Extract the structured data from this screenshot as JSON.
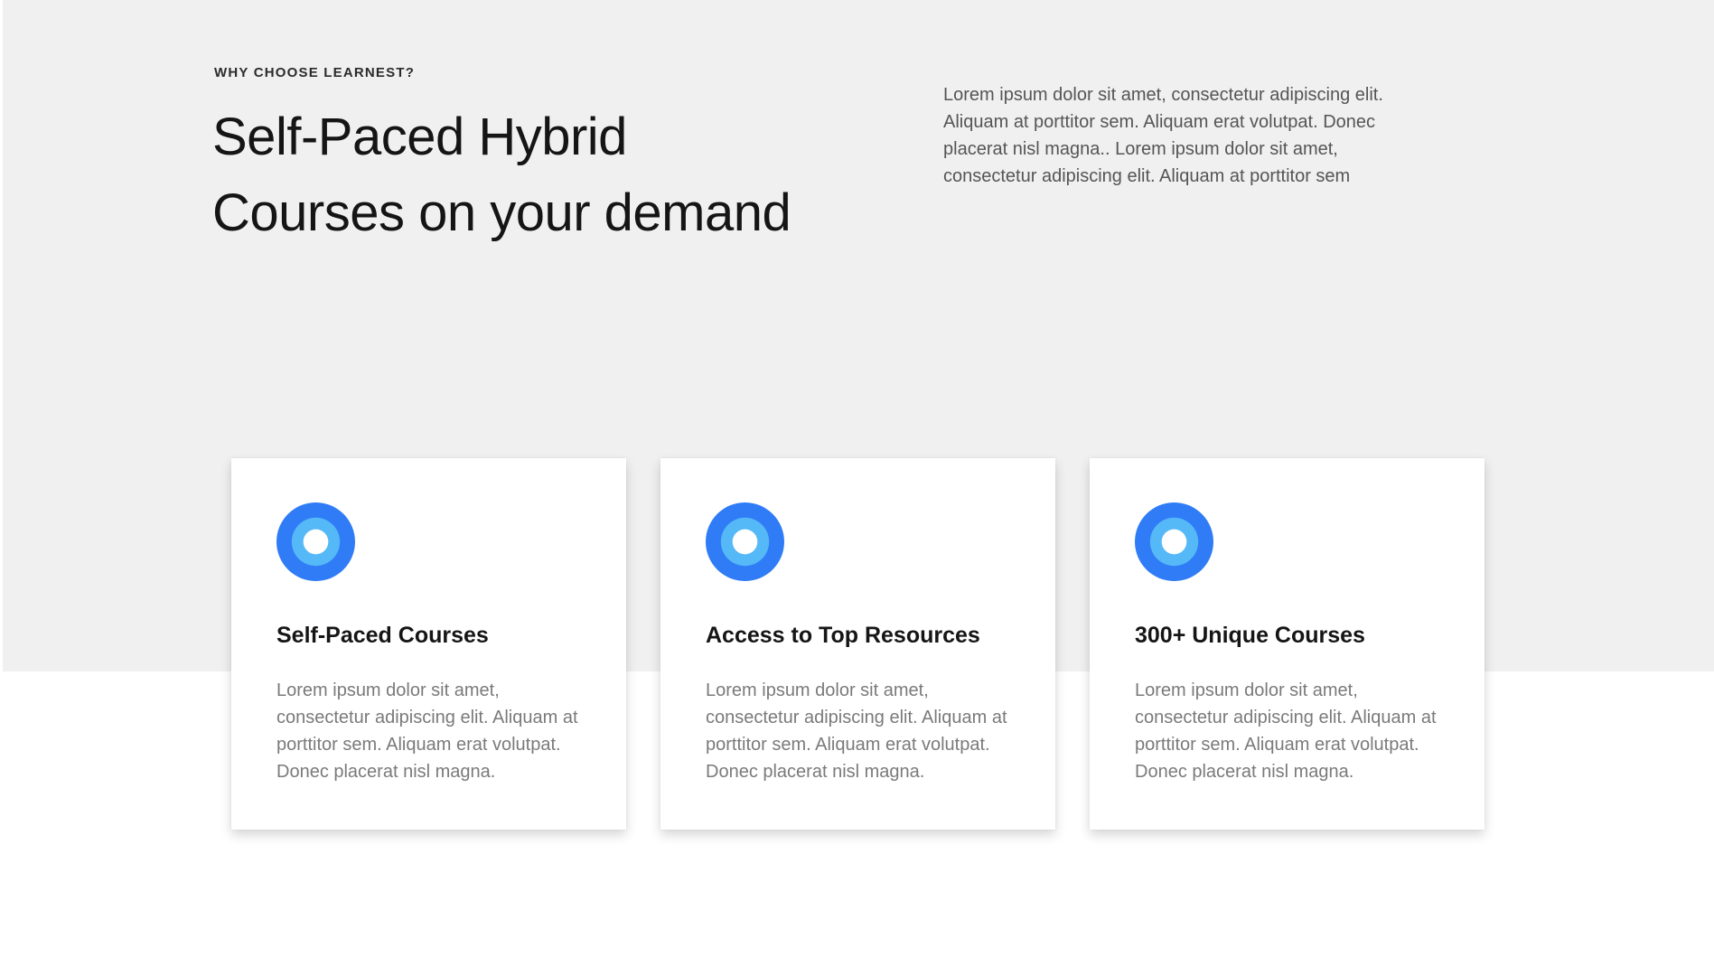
{
  "section": {
    "eyebrow": "WHY CHOOSE LEARNEST?",
    "headline_line1": "Self-Paced Hybrid",
    "headline_line2": "Courses on your demand",
    "intro": "Lorem ipsum dolor sit amet, consectetur adipiscing elit. Aliquam at porttitor sem. Aliquam erat volutpat. Donec placerat nisl magna.. Lorem ipsum dolor sit amet, consectetur adipiscing elit. Aliquam at porttitor sem"
  },
  "cards": [
    {
      "icon": "target-circle-icon",
      "title": "Self-Paced Courses",
      "text": "Lorem ipsum dolor sit amet, consectetur adipiscing elit. Aliquam at porttitor sem. Aliquam erat volutpat. Donec placerat nisl magna."
    },
    {
      "icon": "target-circle-icon",
      "title": "Access to Top Resources",
      "text": "Lorem ipsum dolor sit amet, consectetur adipiscing elit. Aliquam at porttitor sem. Aliquam erat volutpat. Donec placerat nisl magna."
    },
    {
      "icon": "target-circle-icon",
      "title": "300+ Unique Courses",
      "text": "Lorem ipsum dolor sit amet, consectetur adipiscing elit. Aliquam at porttitor sem. Aliquam erat volutpat. Donec placerat nisl magna."
    }
  ],
  "colors": {
    "band_background": "#f0f0f0",
    "icon_outer": "#2f7cf6",
    "icon_middle": "#55b8f7",
    "icon_inner": "#ffffff",
    "heading_text": "#151515",
    "body_text": "#7a7a7a"
  }
}
